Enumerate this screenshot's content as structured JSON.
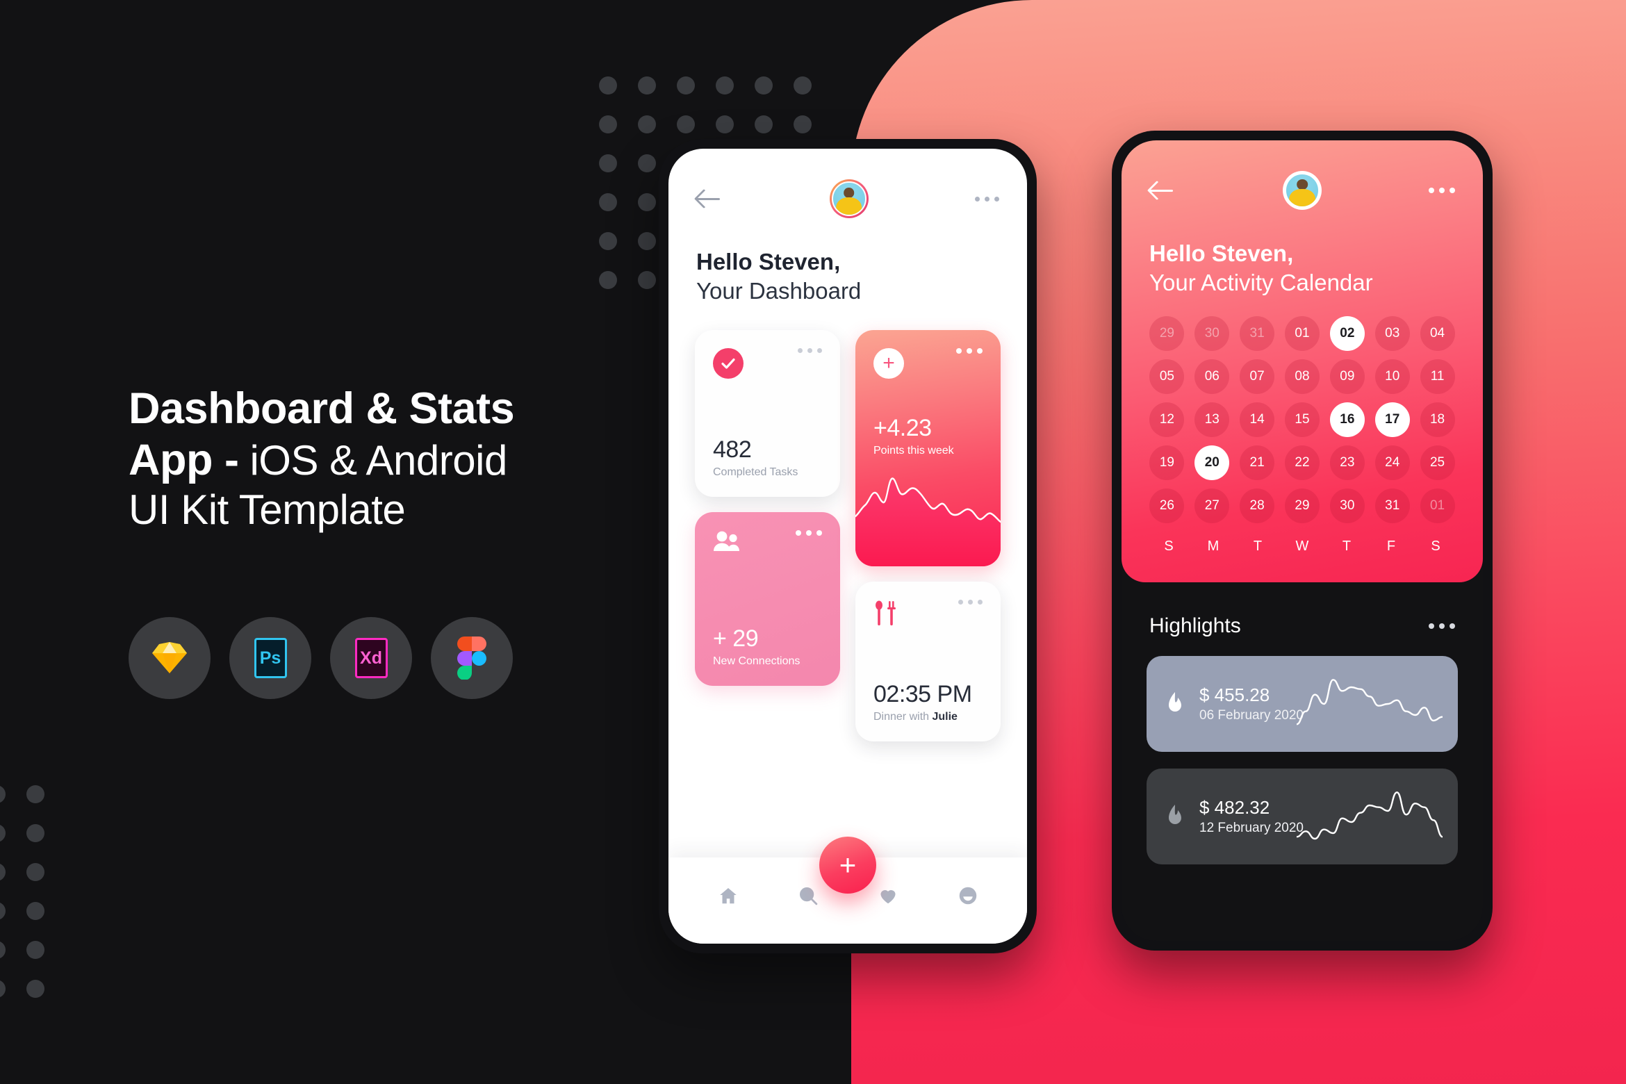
{
  "marketing": {
    "headline_line1_bold": "Dashboard & Stats",
    "headline_line2_bold": "App -",
    "headline_line2_thin": "iOS & Android",
    "headline_line3_thin": "UI Kit Template",
    "badges": [
      {
        "name": "sketch-badge",
        "label": "Sketch",
        "color": "#f7b500"
      },
      {
        "name": "photoshop-badge",
        "label": "Ps",
        "color": "#31c5f0"
      },
      {
        "name": "xd-badge",
        "label": "Xd",
        "color": "#ff2bc2"
      },
      {
        "name": "figma-badge",
        "label": "Figma",
        "color": "#0acf83"
      }
    ]
  },
  "theme": {
    "background": "#121214",
    "panel_gradient_start": "#faa293",
    "panel_gradient_end": "#f3254e",
    "accent_pink": "#f43f6a",
    "accent_red": "#fb2353"
  },
  "dashboard": {
    "greeting_bold": "Hello Steven,",
    "greeting_light": "Your Dashboard",
    "cards": {
      "tasks": {
        "value": "482",
        "label": "Completed Tasks",
        "icon": "check-icon"
      },
      "points": {
        "value": "+4.23",
        "label": "Points this week",
        "icon": "plus-icon"
      },
      "connections": {
        "value": "+ 29",
        "label": "New Connections",
        "icon": "people-icon"
      },
      "dinner": {
        "value": "02:35 PM",
        "label_prefix": "Dinner with ",
        "label_name": "Julie",
        "icon": "cutlery-icon"
      }
    },
    "bottom_nav": [
      {
        "name": "nav-home",
        "icon": "home-icon"
      },
      {
        "name": "nav-search",
        "icon": "search-icon"
      },
      {
        "name": "nav-add",
        "icon": "plus-icon",
        "label": "+"
      },
      {
        "name": "nav-favorites",
        "icon": "heart-icon"
      },
      {
        "name": "nav-profile",
        "icon": "smiley-icon"
      }
    ]
  },
  "calendar": {
    "greeting_bold": "Hello Steven,",
    "greeting_light": "Your Activity Calendar",
    "days": [
      {
        "n": "29",
        "state": "muted"
      },
      {
        "n": "30",
        "state": "muted"
      },
      {
        "n": "31",
        "state": "muted"
      },
      {
        "n": "01",
        "state": "normal"
      },
      {
        "n": "02",
        "state": "selected"
      },
      {
        "n": "03",
        "state": "normal"
      },
      {
        "n": "04",
        "state": "normal"
      },
      {
        "n": "05",
        "state": "normal"
      },
      {
        "n": "06",
        "state": "normal"
      },
      {
        "n": "07",
        "state": "normal"
      },
      {
        "n": "08",
        "state": "normal"
      },
      {
        "n": "09",
        "state": "normal"
      },
      {
        "n": "10",
        "state": "normal"
      },
      {
        "n": "11",
        "state": "normal"
      },
      {
        "n": "12",
        "state": "normal"
      },
      {
        "n": "13",
        "state": "normal"
      },
      {
        "n": "14",
        "state": "normal"
      },
      {
        "n": "15",
        "state": "normal"
      },
      {
        "n": "16",
        "state": "selected"
      },
      {
        "n": "17",
        "state": "selected"
      },
      {
        "n": "18",
        "state": "normal"
      },
      {
        "n": "19",
        "state": "normal"
      },
      {
        "n": "20",
        "state": "selected"
      },
      {
        "n": "21",
        "state": "normal"
      },
      {
        "n": "22",
        "state": "normal"
      },
      {
        "n": "23",
        "state": "normal"
      },
      {
        "n": "24",
        "state": "normal"
      },
      {
        "n": "25",
        "state": "normal"
      },
      {
        "n": "26",
        "state": "normal"
      },
      {
        "n": "27",
        "state": "normal"
      },
      {
        "n": "28",
        "state": "normal"
      },
      {
        "n": "29",
        "state": "normal"
      },
      {
        "n": "30",
        "state": "normal"
      },
      {
        "n": "31",
        "state": "normal"
      },
      {
        "n": "01",
        "state": "muted"
      }
    ],
    "weekdays": [
      "S",
      "M",
      "T",
      "W",
      "T",
      "F",
      "S"
    ],
    "highlights_title": "Highlights",
    "highlights": [
      {
        "amount": "$ 455.28",
        "date": "06 February 2020",
        "style": "slate",
        "icon": "flame-icon"
      },
      {
        "amount": "$ 482.32",
        "date": "12 February 2020",
        "style": "dark",
        "icon": "flame-icon"
      }
    ]
  },
  "chart_data": [
    {
      "type": "area",
      "title": "Points this week",
      "x": [
        0,
        1,
        2,
        3,
        4,
        5,
        6,
        7,
        8,
        9,
        10,
        11,
        12,
        13,
        14,
        15,
        16,
        17,
        18,
        19,
        20,
        21,
        22
      ],
      "values": [
        22,
        30,
        44,
        34,
        32,
        62,
        40,
        44,
        48,
        46,
        40,
        34,
        30,
        26,
        32,
        30,
        20,
        18,
        22,
        28,
        20,
        26,
        20
      ],
      "ylim": [
        0,
        70
      ],
      "grid": false,
      "legend": false
    },
    {
      "type": "line",
      "title": "$ 455.28 — 06 February 2020",
      "x": [
        0,
        1,
        2,
        3,
        4,
        5,
        6,
        7,
        8,
        9,
        10,
        11,
        12,
        13,
        14,
        15,
        16
      ],
      "values": [
        8,
        22,
        40,
        30,
        56,
        44,
        48,
        46,
        38,
        28,
        30,
        34,
        22,
        18,
        26,
        12,
        16
      ],
      "ylim": [
        0,
        60
      ],
      "grid": false,
      "legend": false
    },
    {
      "type": "line",
      "title": "$ 482.32 — 12 February 2020",
      "x": [
        0,
        1,
        2,
        3,
        4,
        5,
        6,
        7,
        8,
        9,
        10,
        11,
        12,
        13,
        14,
        15,
        16
      ],
      "values": [
        8,
        14,
        6,
        16,
        12,
        28,
        24,
        34,
        42,
        40,
        36,
        56,
        32,
        44,
        40,
        26,
        8
      ],
      "ylim": [
        0,
        60
      ],
      "grid": false,
      "legend": false
    }
  ]
}
